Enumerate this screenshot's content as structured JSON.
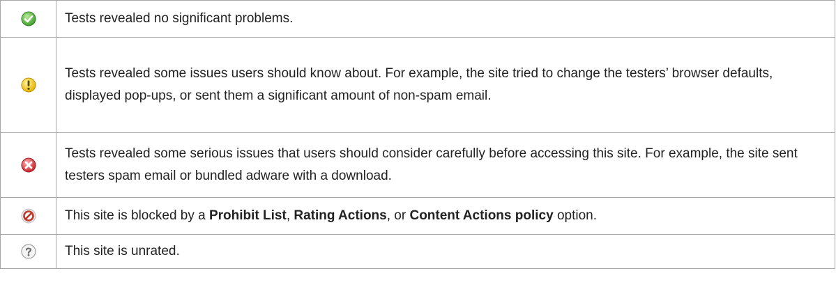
{
  "rows": [
    {
      "icon": "green-check-icon",
      "text": "Tests revealed no significant problems."
    },
    {
      "icon": "yellow-exclamation-icon",
      "text": "Tests revealed some issues users should know about. For example, the site tried to change the testers’ browser defaults, displayed pop‑ups, or sent them a significant amount of non‑spam email."
    },
    {
      "icon": "red-x-icon",
      "text": "Tests revealed some serious issues that users should consider carefully before accessing this site. For example, the site sent testers spam email or bundled adware with a download."
    },
    {
      "icon": "blocked-icon",
      "text_before": "This site is blocked by a ",
      "bold_1": "Prohibit List",
      "sep_1": ", ",
      "bold_2": "Rating Actions",
      "sep_2": ", or ",
      "bold_3": "Content Actions policy",
      "text_after": " option."
    },
    {
      "icon": "question-mark-icon",
      "text": "This site is unrated."
    }
  ],
  "colors": {
    "border": "#a6a6a6",
    "text": "#222222",
    "check": "#4caf3c",
    "warning": "#f2c200",
    "danger": "#d9363e",
    "blocked": "#c0392b",
    "unrated": "#9a9a9a"
  }
}
